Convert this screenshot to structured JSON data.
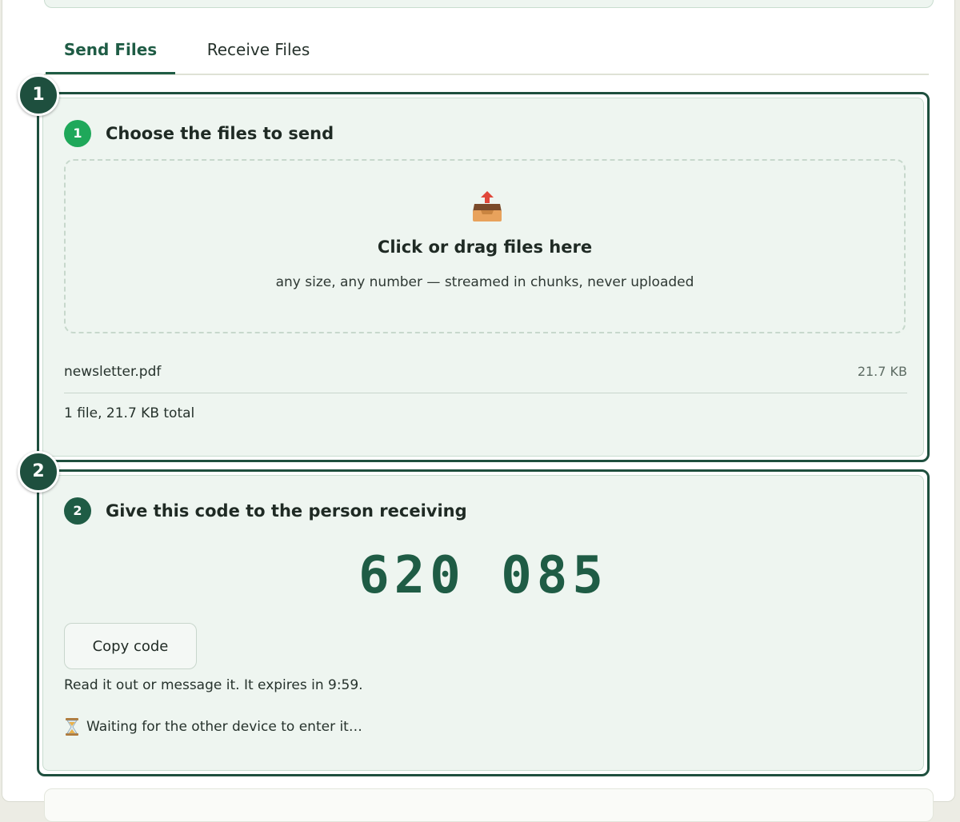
{
  "tabs": [
    {
      "label": "Send Files",
      "active": true
    },
    {
      "label": "Receive Files",
      "active": false
    }
  ],
  "step1": {
    "marker": "1",
    "badge": "1",
    "title": "Choose the files to send",
    "dropzone": {
      "icon": "outbox-tray-icon",
      "title": "Click or drag files here",
      "subtitle": "any size, any number — streamed in chunks, never uploaded"
    },
    "files": [
      {
        "name": "newsletter.pdf",
        "size": "21.7 KB"
      }
    ],
    "total": "1 file, 21.7 KB total"
  },
  "step2": {
    "marker": "2",
    "badge": "2",
    "title": "Give this code to the person receiving",
    "code": "620 085",
    "copy_label": "Copy code",
    "expire_text": "Read it out or message it. It expires in 9:59.",
    "waiting_icon": "hourglass-icon",
    "waiting_text": "Waiting for the other device to enter it…"
  },
  "colors": {
    "accent": "#1f5c45",
    "badge_green": "#1fa85a",
    "card_bg": "#eef5f0"
  }
}
